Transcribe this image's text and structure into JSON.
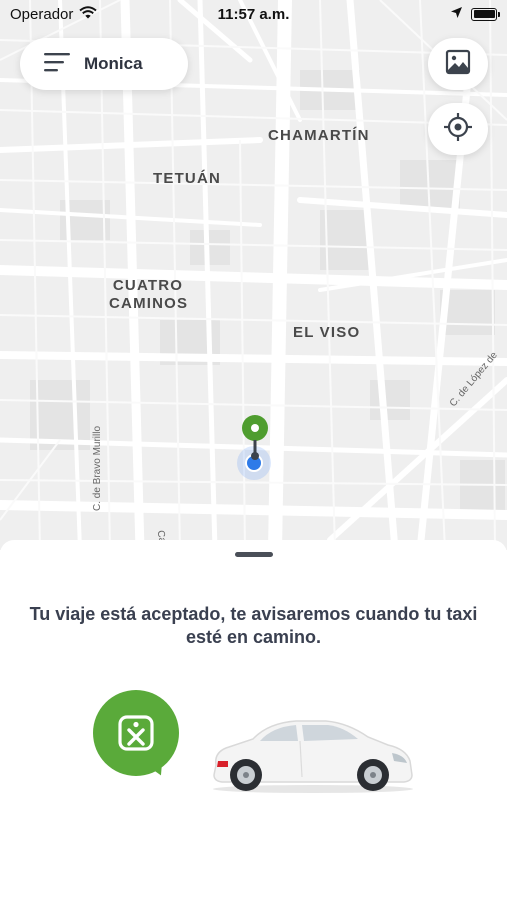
{
  "status_bar": {
    "carrier": "Operador",
    "time": "11:57 a.m."
  },
  "header": {
    "user_name": "Monica"
  },
  "map": {
    "districts": {
      "chamartin": "CHAMARTÍN",
      "tetuan": "TETUÁN",
      "cuatro_caminos_line1": "CUATRO",
      "cuatro_caminos_line2": "CAMINOS",
      "el_viso": "EL VISO"
    },
    "streets": {
      "bravo_murillo": "C. de Bravo Murillo",
      "lopez": "C. de López de",
      "calle_partial": "Calle"
    }
  },
  "sheet": {
    "message": "Tu viaje está aceptado, te avisaremos cuando tu taxi esté en camino."
  },
  "colors": {
    "brand_green": "#5aaa3a",
    "user_blue": "#2f7be8",
    "pin_green": "#4f9d2f"
  },
  "icons": {
    "menu": "hamburger-menu-icon",
    "layers": "image-layers-icon",
    "locate": "crosshair-locate-icon",
    "brand": "taxi-brand-logo"
  }
}
